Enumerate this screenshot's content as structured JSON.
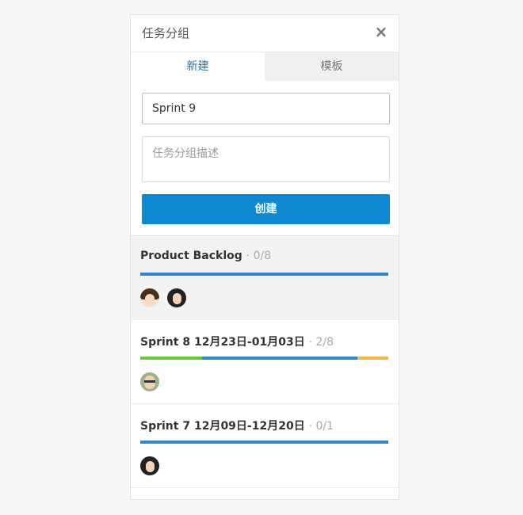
{
  "header": {
    "title": "任务分组",
    "close_icon": "×"
  },
  "tabs": [
    {
      "label": "新建",
      "active": true
    },
    {
      "label": "模板",
      "active": false
    }
  ],
  "form": {
    "name_value": "Sprint 9",
    "description_placeholder": "任务分组描述",
    "create_label": "创建"
  },
  "groups": [
    {
      "name": "Product Backlog",
      "count": "· 0/8",
      "selected": true,
      "progress": [
        {
          "fraction": 1.0,
          "color": "#3088c8"
        }
      ],
      "avatars": [
        "female-avatar",
        "female-avatar"
      ]
    },
    {
      "name": "Sprint 8 12月23日-01月03日",
      "count": "· 2/8",
      "selected": false,
      "progress": [
        {
          "fraction": 0.25,
          "color": "#6cc644"
        },
        {
          "fraction": 0.625,
          "color": "#3088c8"
        },
        {
          "fraction": 0.125,
          "color": "#f5b34b"
        }
      ],
      "avatars": [
        "male-avatar"
      ]
    },
    {
      "name": "Sprint 7 12月09日-12月20日",
      "count": "· 0/1",
      "selected": false,
      "progress": [
        {
          "fraction": 1.0,
          "color": "#3088c8"
        }
      ],
      "avatars": [
        "female-avatar"
      ]
    }
  ]
}
